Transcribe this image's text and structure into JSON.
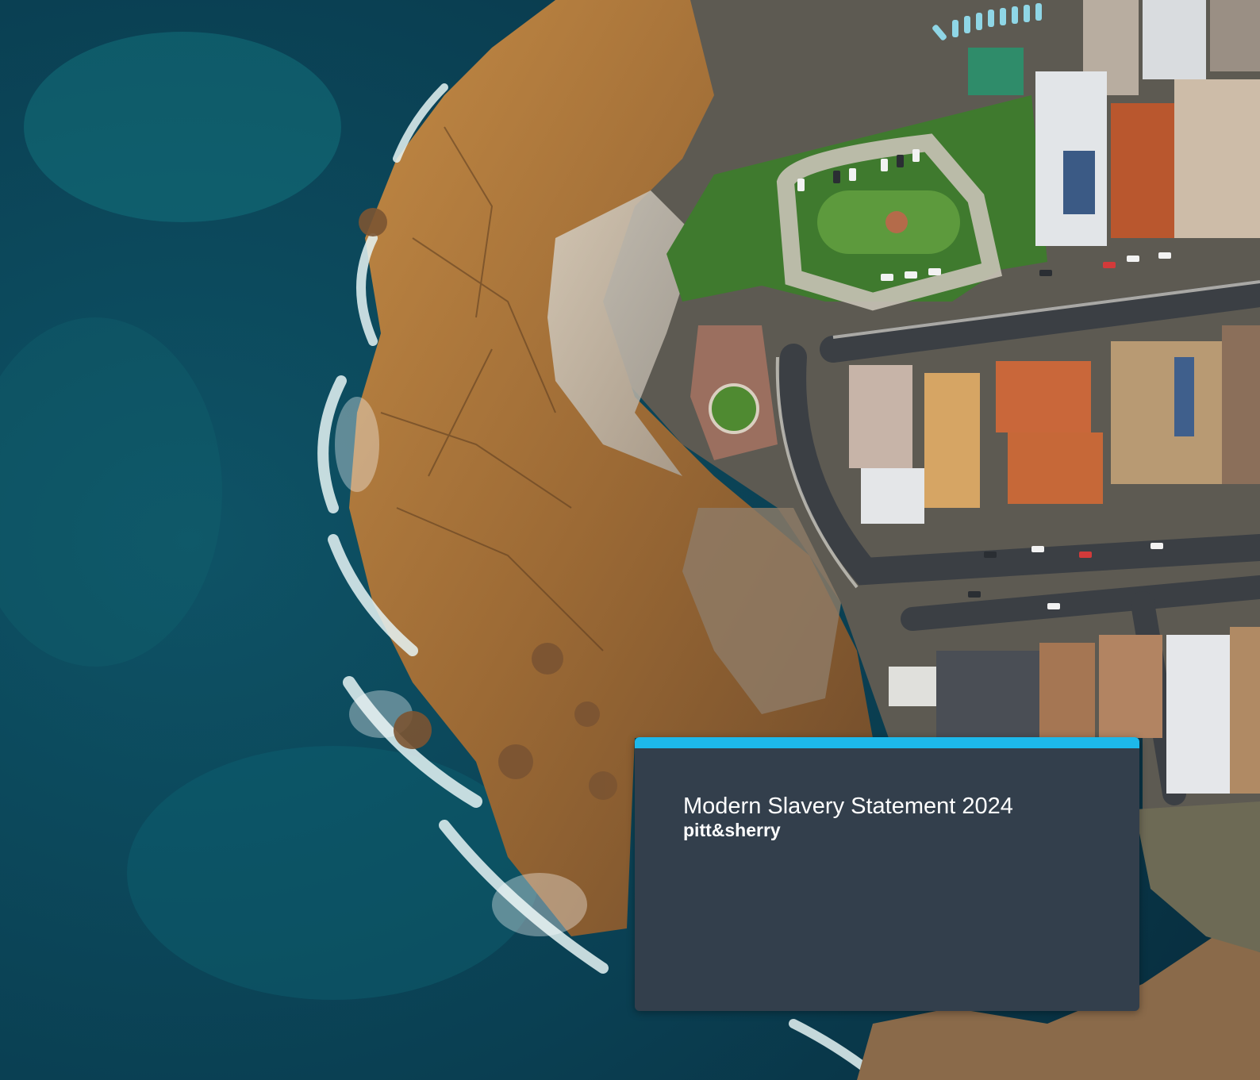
{
  "cover": {
    "title": "Modern Slavery Statement 2024",
    "brand": "pitt&sherry"
  },
  "colors": {
    "card_background": "#333f4c",
    "accent_bar": "#1db8ea",
    "ocean": "#0b3a4a",
    "rock": "#a8763a"
  },
  "background_photo": "aerial-coastline-photo"
}
